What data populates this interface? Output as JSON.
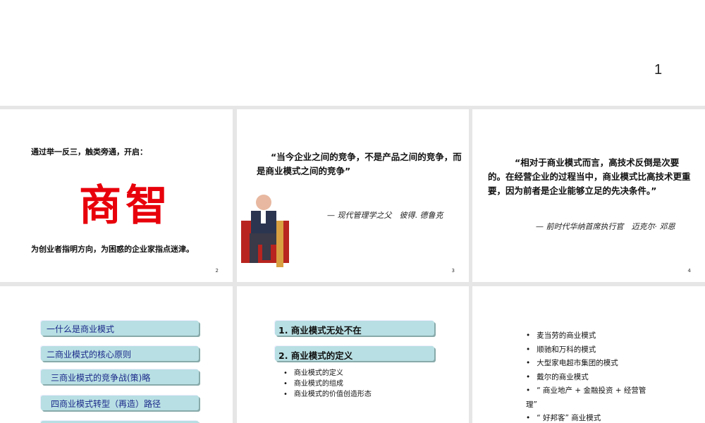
{
  "page_number": "1",
  "slides": [
    {
      "num": "2",
      "line1": "通过举一反三，触类旁通，开启：",
      "big": "商智",
      "line2": "为创业者指明方向，为困惑的企业家指点迷津。"
    },
    {
      "num": "3",
      "quote": "“当今企业之间的竞争，不是产品之间的竞争，而是商业模式之间的竞争”",
      "author": "— 现代管理学之父　彼得. 德鲁克"
    },
    {
      "num": "4",
      "quote": "“相对于商业模式而言，高技术反倒是次要的。在经营企业的过程当中，商业模式比高技术更重要，因为前者是企业能够立足的先决条件。”",
      "author": "— 前时代华纳首席执行官　迈克尔· 邓恩"
    },
    {
      "menu": [
        "一什么是商业模式",
        "二商业模式的核心原则",
        "三商业模式的竞争战(策)略",
        "四商业模式转型（再造）路径"
      ]
    },
    {
      "sections": [
        "1. 商业模式无处不在",
        "2. 商业模式的定义"
      ],
      "bullets": [
        "商业模式的定义",
        "商业模式的组成",
        "商业模式的价值创造形态"
      ]
    },
    {
      "bullets": [
        "麦当劳的商业模式",
        "顺驰和万科的模式",
        "大型家电超市集团的模式",
        "戴尔的商业模式",
        "“ 商业地产 + 金融投资 + 经营管理”",
        "“ 好邦客” 商业模式"
      ]
    }
  ]
}
